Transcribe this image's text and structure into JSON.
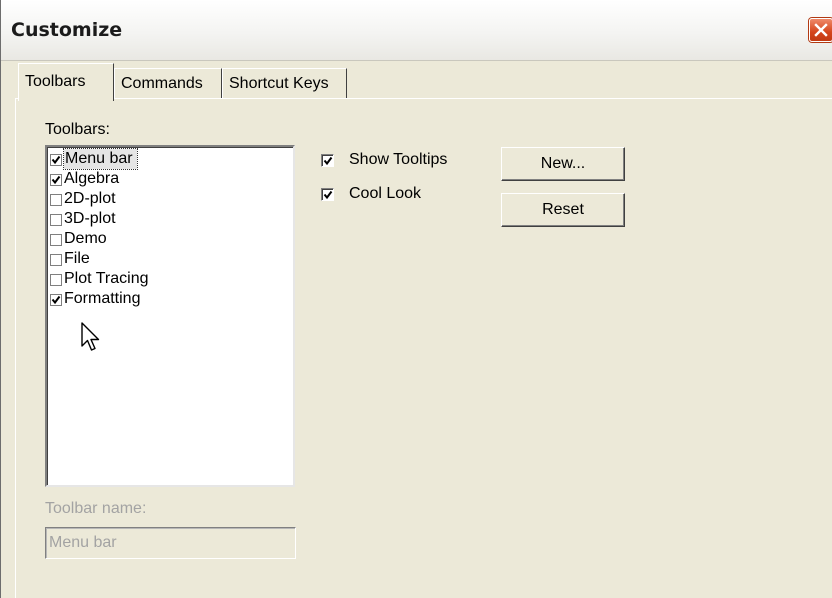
{
  "window": {
    "title": "Customize"
  },
  "tabs": [
    {
      "label": "Toolbars",
      "active": true
    },
    {
      "label": "Commands",
      "active": false
    },
    {
      "label": "Shortcut Keys",
      "active": false
    }
  ],
  "toolbars_panel": {
    "list_label": "Toolbars:",
    "items": [
      {
        "label": "Menu bar",
        "checked": true,
        "selected": true
      },
      {
        "label": "Algebra",
        "checked": true,
        "selected": false
      },
      {
        "label": "2D-plot",
        "checked": false,
        "selected": false
      },
      {
        "label": "3D-plot",
        "checked": false,
        "selected": false
      },
      {
        "label": "Demo",
        "checked": false,
        "selected": false
      },
      {
        "label": "File",
        "checked": false,
        "selected": false
      },
      {
        "label": "Plot Tracing",
        "checked": false,
        "selected": false
      },
      {
        "label": "Formatting",
        "checked": true,
        "selected": false
      }
    ],
    "options": [
      {
        "label": "Show Tooltips",
        "checked": true
      },
      {
        "label": "Cool Look",
        "checked": true
      }
    ],
    "buttons": {
      "new_label": "New...",
      "reset_label": "Reset"
    },
    "toolbar_name_label": "Toolbar name:",
    "toolbar_name_value": "Menu bar"
  },
  "icons": {
    "close": "close-icon",
    "checkmark": "checkmark-icon",
    "cursor": "mouse-pointer-icon"
  },
  "colors": {
    "dialog_bg": "#ece9d8",
    "close_button": "#d4451b",
    "disabled_text": "#a3a3a3"
  }
}
